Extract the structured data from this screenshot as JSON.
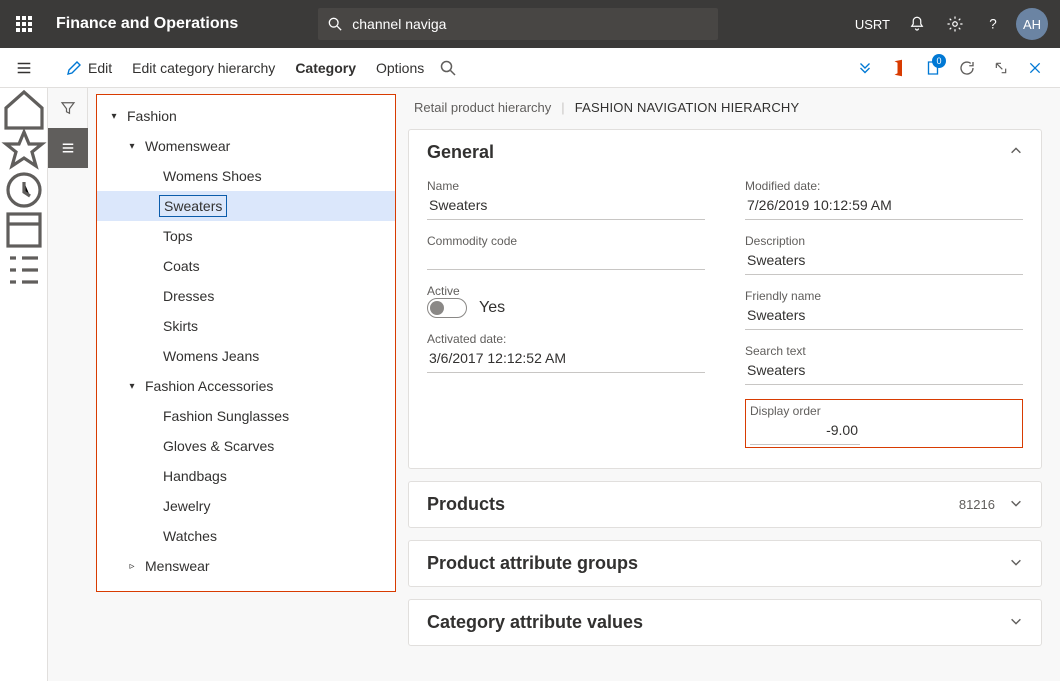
{
  "topbar": {
    "title": "Finance and Operations",
    "search_value": "channel naviga",
    "user_label": "USRT",
    "avatar_initials": "AH"
  },
  "cmdbar": {
    "edit": "Edit",
    "edit_hierarchy": "Edit category hierarchy",
    "category": "Category",
    "options": "Options",
    "doc_badge": "0"
  },
  "tree": {
    "n0": {
      "label": "Fashion"
    },
    "n1": {
      "label": "Womenswear"
    },
    "n1_0": {
      "label": "Womens Shoes"
    },
    "n1_1": {
      "label": "Sweaters"
    },
    "n1_2": {
      "label": "Tops"
    },
    "n1_3": {
      "label": "Coats"
    },
    "n1_4": {
      "label": "Dresses"
    },
    "n1_5": {
      "label": "Skirts"
    },
    "n1_6": {
      "label": "Womens Jeans"
    },
    "n2": {
      "label": "Fashion Accessories"
    },
    "n2_0": {
      "label": "Fashion Sunglasses"
    },
    "n2_1": {
      "label": "Gloves & Scarves"
    },
    "n2_2": {
      "label": "Handbags"
    },
    "n2_3": {
      "label": "Jewelry"
    },
    "n2_4": {
      "label": "Watches"
    },
    "n3": {
      "label": "Menswear"
    }
  },
  "breadcrumb": {
    "parent": "Retail product hierarchy",
    "current": "FASHION NAVIGATION HIERARCHY"
  },
  "sections": {
    "general": "General",
    "products": "Products",
    "products_count": "81216",
    "product_attr_groups": "Product attribute groups",
    "category_attr_values": "Category attribute values"
  },
  "general": {
    "name_label": "Name",
    "name_value": "Sweaters",
    "commodity_label": "Commodity code",
    "commodity_value": "",
    "active_label": "Active",
    "active_text": "Yes",
    "activated_label": "Activated date:",
    "activated_value": "3/6/2017 12:12:52 AM",
    "modified_label": "Modified date:",
    "modified_value": "7/26/2019 10:12:59 AM",
    "description_label": "Description",
    "description_value": "Sweaters",
    "friendly_label": "Friendly name",
    "friendly_value": "Sweaters",
    "searchtext_label": "Search text",
    "searchtext_value": "Sweaters",
    "displayorder_label": "Display order",
    "displayorder_value": "-9.00"
  }
}
